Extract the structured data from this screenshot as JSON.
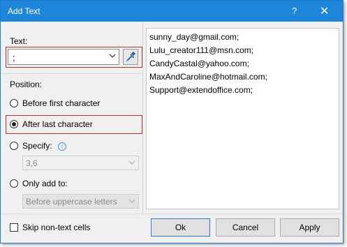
{
  "title": "Add Text",
  "titlebar": {
    "help": "?",
    "close": "✕"
  },
  "text_section": {
    "label": "Text:",
    "value": ";"
  },
  "position_section": {
    "label": "Position:",
    "options": {
      "before_first": "Before first character",
      "after_last": "After last character",
      "specify": "Specify:",
      "only_add_to": "Only add to:"
    },
    "selected": "After last character",
    "specify_value": "3,6",
    "only_add_to_value": "Before uppercase letters"
  },
  "preview": {
    "lines": [
      "sunny_day@gmail.com;",
      "Lulu_creator111@msn.com;",
      "CandyCastal@yahoo.com;",
      "MaxAndCaroline@hotmail.com;",
      "Support@extendoffice.com;"
    ]
  },
  "skip_non_text": {
    "label": "Skip non-text cells",
    "checked": false
  },
  "buttons": {
    "ok": "Ok",
    "cancel": "Cancel",
    "apply": "Apply"
  },
  "colors": {
    "titlebar": "#1e87d9",
    "highlight_border": "#b53333"
  }
}
